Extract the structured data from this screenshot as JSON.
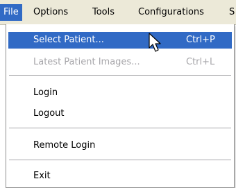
{
  "menubar": {
    "items": [
      {
        "label": "File",
        "active": true
      },
      {
        "label": "Options",
        "active": false
      },
      {
        "label": "Tools",
        "active": false
      },
      {
        "label": "Configurations",
        "active": false
      },
      {
        "label": "S",
        "active": false
      }
    ]
  },
  "file_menu": {
    "select_patient": {
      "label": "Select Patient...",
      "shortcut": "Ctrl+P",
      "highlighted": true
    },
    "latest_patient_images": {
      "label": "Latest Patient Images...",
      "shortcut": "Ctrl+L",
      "enabled": false
    },
    "login": {
      "label": "Login"
    },
    "logout": {
      "label": "Logout"
    },
    "remote_login": {
      "label": "Remote Login"
    },
    "exit": {
      "label": "Exit"
    }
  },
  "colors": {
    "highlight": "#316ac5",
    "menubar_bg": "#ece9d8",
    "disabled_text": "#a7a6aa"
  },
  "icons": {
    "cursor": "mouse-pointer-icon"
  }
}
